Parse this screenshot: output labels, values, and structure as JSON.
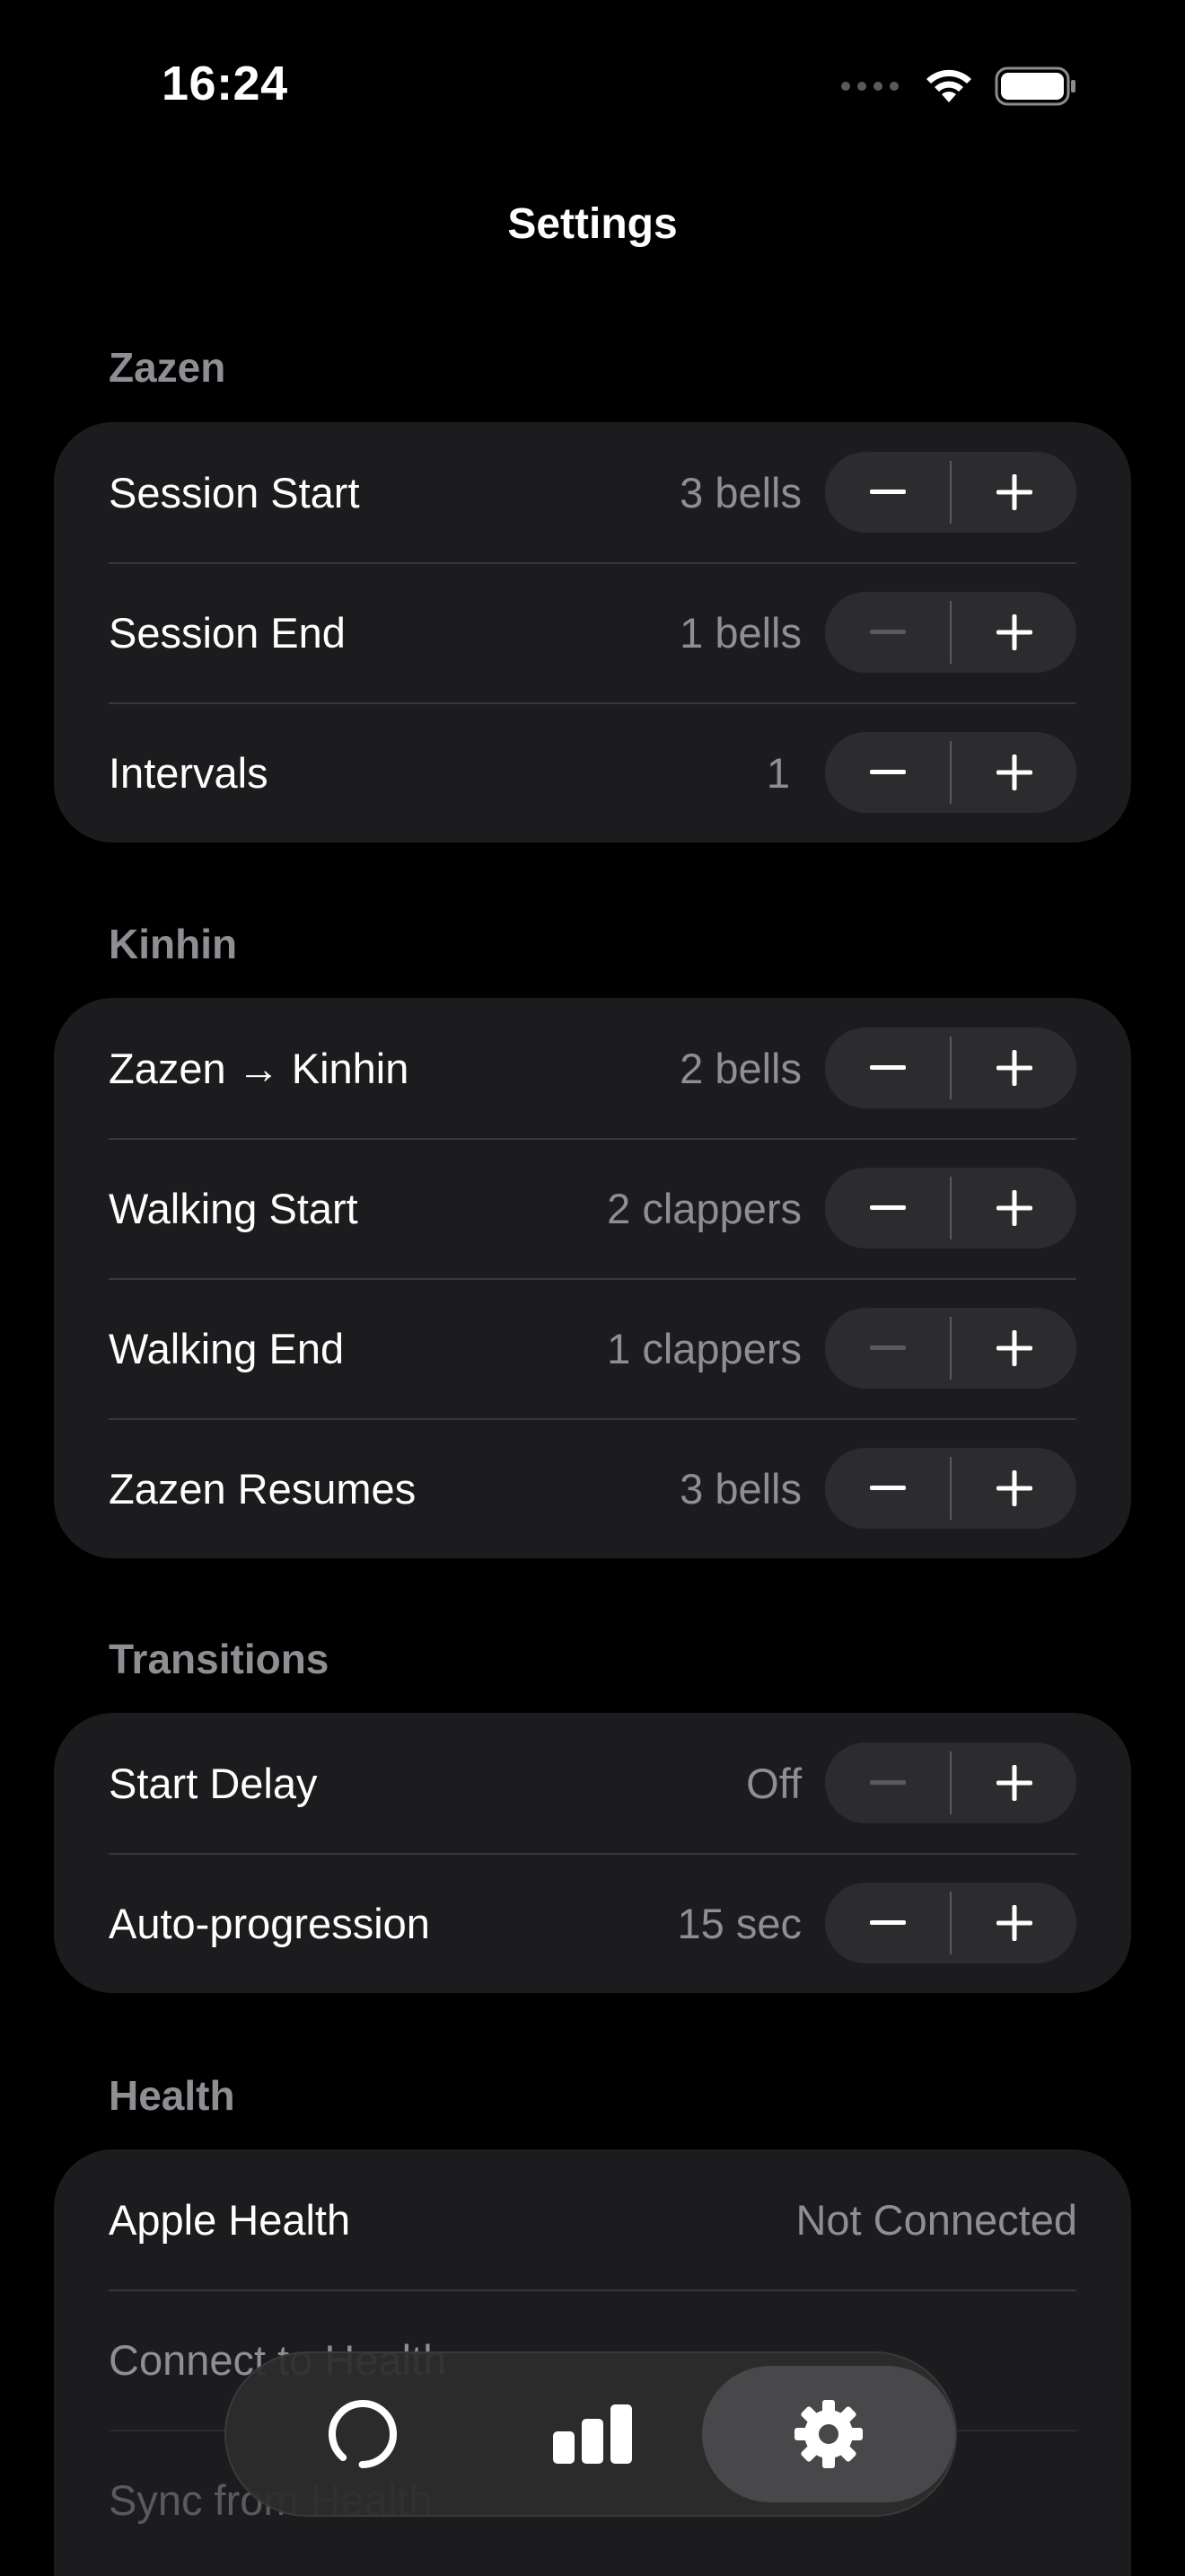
{
  "status_bar": {
    "time": "16:24",
    "icons": [
      "signal-dots-icon",
      "wifi-icon",
      "battery-icon"
    ]
  },
  "nav": {
    "title": "Settings"
  },
  "sections": {
    "zazen": {
      "header": "Zazen",
      "rows": [
        {
          "label": "Session Start",
          "value": "3 bells"
        },
        {
          "label": "Session End",
          "value": "1 bells"
        },
        {
          "label": "Intervals",
          "value": "1"
        }
      ]
    },
    "kinhin": {
      "header": "Kinhin",
      "rows": [
        {
          "label": "Zazen → Kinhin",
          "value": "2 bells"
        },
        {
          "label": "Walking Start",
          "value": "2 clappers"
        },
        {
          "label": "Walking End",
          "value": "1 clappers"
        },
        {
          "label": "Zazen Resumes",
          "value": "3 bells"
        }
      ]
    },
    "transitions": {
      "header": "Transitions",
      "rows": [
        {
          "label": "Start Delay",
          "value": "Off"
        },
        {
          "label": "Auto-progression",
          "value": "15 sec"
        }
      ]
    },
    "health": {
      "header": "Health",
      "rows": [
        {
          "label": "Apple Health",
          "value": "Not Connected"
        },
        {
          "label": "Connect to Health"
        },
        {
          "label": "Sync from Health"
        }
      ]
    }
  },
  "tab_bar": {
    "tabs": [
      {
        "icon": "timer-ring-icon"
      },
      {
        "icon": "stats-bars-icon"
      },
      {
        "icon": "gear-icon",
        "active": true
      }
    ]
  },
  "colors": {
    "background": "#000000",
    "card": "#1c1c1e",
    "stepper": "#2c2c2e",
    "secondary_text": "#8e8e93",
    "disabled": "#5a5a5e"
  }
}
